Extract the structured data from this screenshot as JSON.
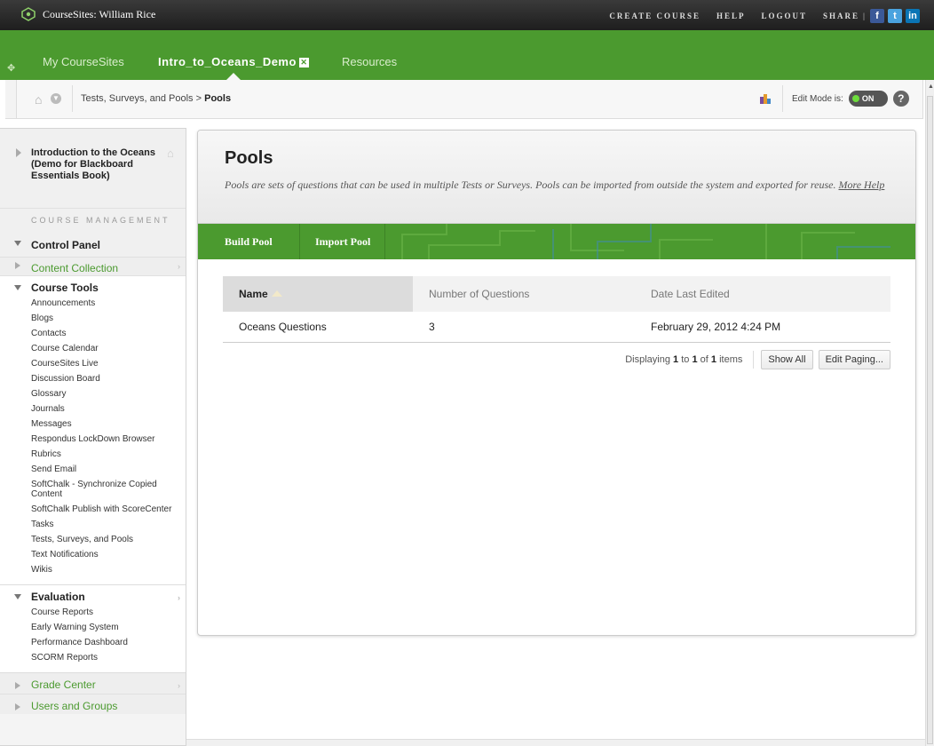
{
  "topbar": {
    "site_title": "CourseSites: William Rice",
    "links": [
      "CREATE COURSE",
      "HELP",
      "LOGOUT"
    ],
    "share_label": "SHARE",
    "separator": "|",
    "social": {
      "facebook": "f",
      "twitter": "t",
      "linkedin": "in"
    }
  },
  "tabs": {
    "items": [
      {
        "label": "My CourseSites"
      },
      {
        "label": "Intro_to_Oceans_Demo"
      },
      {
        "label": "Resources"
      }
    ],
    "close_glyph": "✕"
  },
  "breadcrumb": {
    "parent": "Tests, Surveys, and Pools",
    "separator": ">",
    "current": "Pools"
  },
  "edit_mode": {
    "label": "Edit Mode is:",
    "state": "ON",
    "help": "?"
  },
  "sidebar": {
    "course_title": "Introduction to the Oceans (Demo for Blackboard Essentials Book)",
    "course_management_label": "COURSE MANAGEMENT",
    "control_panel": "Control Panel",
    "content_collection": "Content Collection",
    "course_tools": {
      "title": "Course Tools",
      "items": [
        "Announcements",
        "Blogs",
        "Contacts",
        "Course Calendar",
        "CourseSites Live",
        "Discussion Board",
        "Glossary",
        "Journals",
        "Messages",
        "Respondus LockDown Browser",
        "Rubrics",
        "Send Email",
        "SoftChalk - Synchronize Copied Content",
        "SoftChalk Publish with ScoreCenter",
        "Tasks",
        "Tests, Surveys, and Pools",
        "Text Notifications",
        "Wikis"
      ]
    },
    "evaluation": {
      "title": "Evaluation",
      "items": [
        "Course Reports",
        "Early Warning System",
        "Performance Dashboard",
        "SCORM Reports"
      ]
    },
    "grade_center": "Grade Center",
    "users_and_groups": "Users and Groups"
  },
  "main": {
    "title": "Pools",
    "description": "Pools are sets of questions that can be used in multiple Tests or Surveys. Pools can be imported from outside the system and exported for reuse.",
    "more_help": "More Help",
    "actions": {
      "build_pool": "Build Pool",
      "import_pool": "Import Pool"
    },
    "table": {
      "headers": [
        "Name",
        "Number of Questions",
        "Date Last Edited"
      ],
      "rows": [
        {
          "name": "Oceans Questions",
          "count": "3",
          "date": "February 29, 2012 4:24 PM"
        }
      ]
    },
    "pager": {
      "displaying": "Displaying",
      "from": "1",
      "to_word": "to",
      "to": "1",
      "of_word": "of",
      "total": "1",
      "items_word": "items",
      "show_all": "Show All",
      "edit_paging": "Edit Paging..."
    }
  },
  "colors": {
    "brand_green": "#4b9a2f",
    "topbar_dark": "#2a2a2a",
    "toggle_on": "#6ddc3c"
  }
}
